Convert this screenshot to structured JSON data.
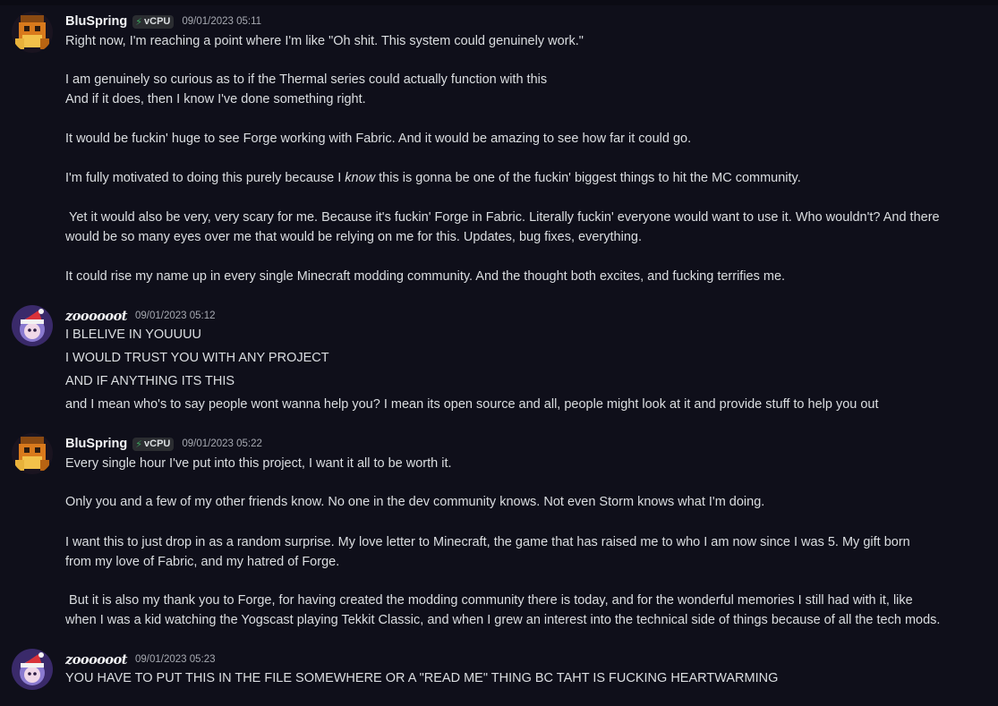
{
  "messages": [
    {
      "author": "BluSpring",
      "badge": "vCPU",
      "timestamp": "09/01/2023 05:11",
      "lines": [
        "Right now, I'm reaching a point where I'm like \"Oh shit. This system could genuinely work.\"",
        "I am genuinely so curious as to if the Thermal series could actually function with this",
        "And if it does, then I know I've done something right.",
        "It would be fuckin' huge to see Forge working with Fabric. And it would be amazing to see how far it could go.",
        "I'm fully motivated to doing this purely because I",
        "know",
        "this is gonna be one of the fuckin' biggest things to hit the MC community.",
        " Yet it would also be very, very scary for me. Because it's fuckin' Forge in Fabric. Literally fuckin' everyone would want to use it. Who wouldn't? And there",
        "would be so many eyes over me that would be relying on me for this. Updates, bug fixes, everything.",
        "It could rise my name up in every single Minecraft modding community. And the thought both excites, and fucking terrifies me."
      ]
    },
    {
      "author": "zoooooot",
      "timestamp": "09/01/2023 05:12",
      "lines": [
        "I BLELIVE IN YOUUUU",
        "I WOULD TRUST YOU WITH ANY PROJECT",
        "AND IF ANYTHING ITS THIS",
        "and I mean who's to say people wont wanna help you? I mean its open source and all, people might look at it and provide stuff to help you out"
      ]
    },
    {
      "author": "BluSpring",
      "badge": "vCPU",
      "timestamp": "09/01/2023 05:22",
      "lines": [
        "Every single hour I've put into this project, I want it all to be worth it.",
        "Only you and a few of my other friends know. No one in the dev community knows. Not even Storm knows what I'm doing.",
        "I want this to just drop in as a random surprise. My love letter to Minecraft, the game that has raised me to who I am now since I was 5. My gift born",
        "from my love of Fabric, and my hatred of Forge.",
        " But it is also my thank you to Forge, for having created the modding community there is today, and for the wonderful memories I still had with it, like",
        "when I was a kid watching the Yogscast playing Tekkit Classic, and when I grew an interest into the technical side of things because of all the tech mods."
      ]
    },
    {
      "author": "zoooooot",
      "timestamp": "09/01/2023 05:23",
      "lines": [
        "YOU HAVE TO PUT THIS IN THE FILE SOMEWHERE OR A \"READ ME\" THING BC TAHT IS FUCKING HEARTWARMING"
      ]
    }
  ]
}
